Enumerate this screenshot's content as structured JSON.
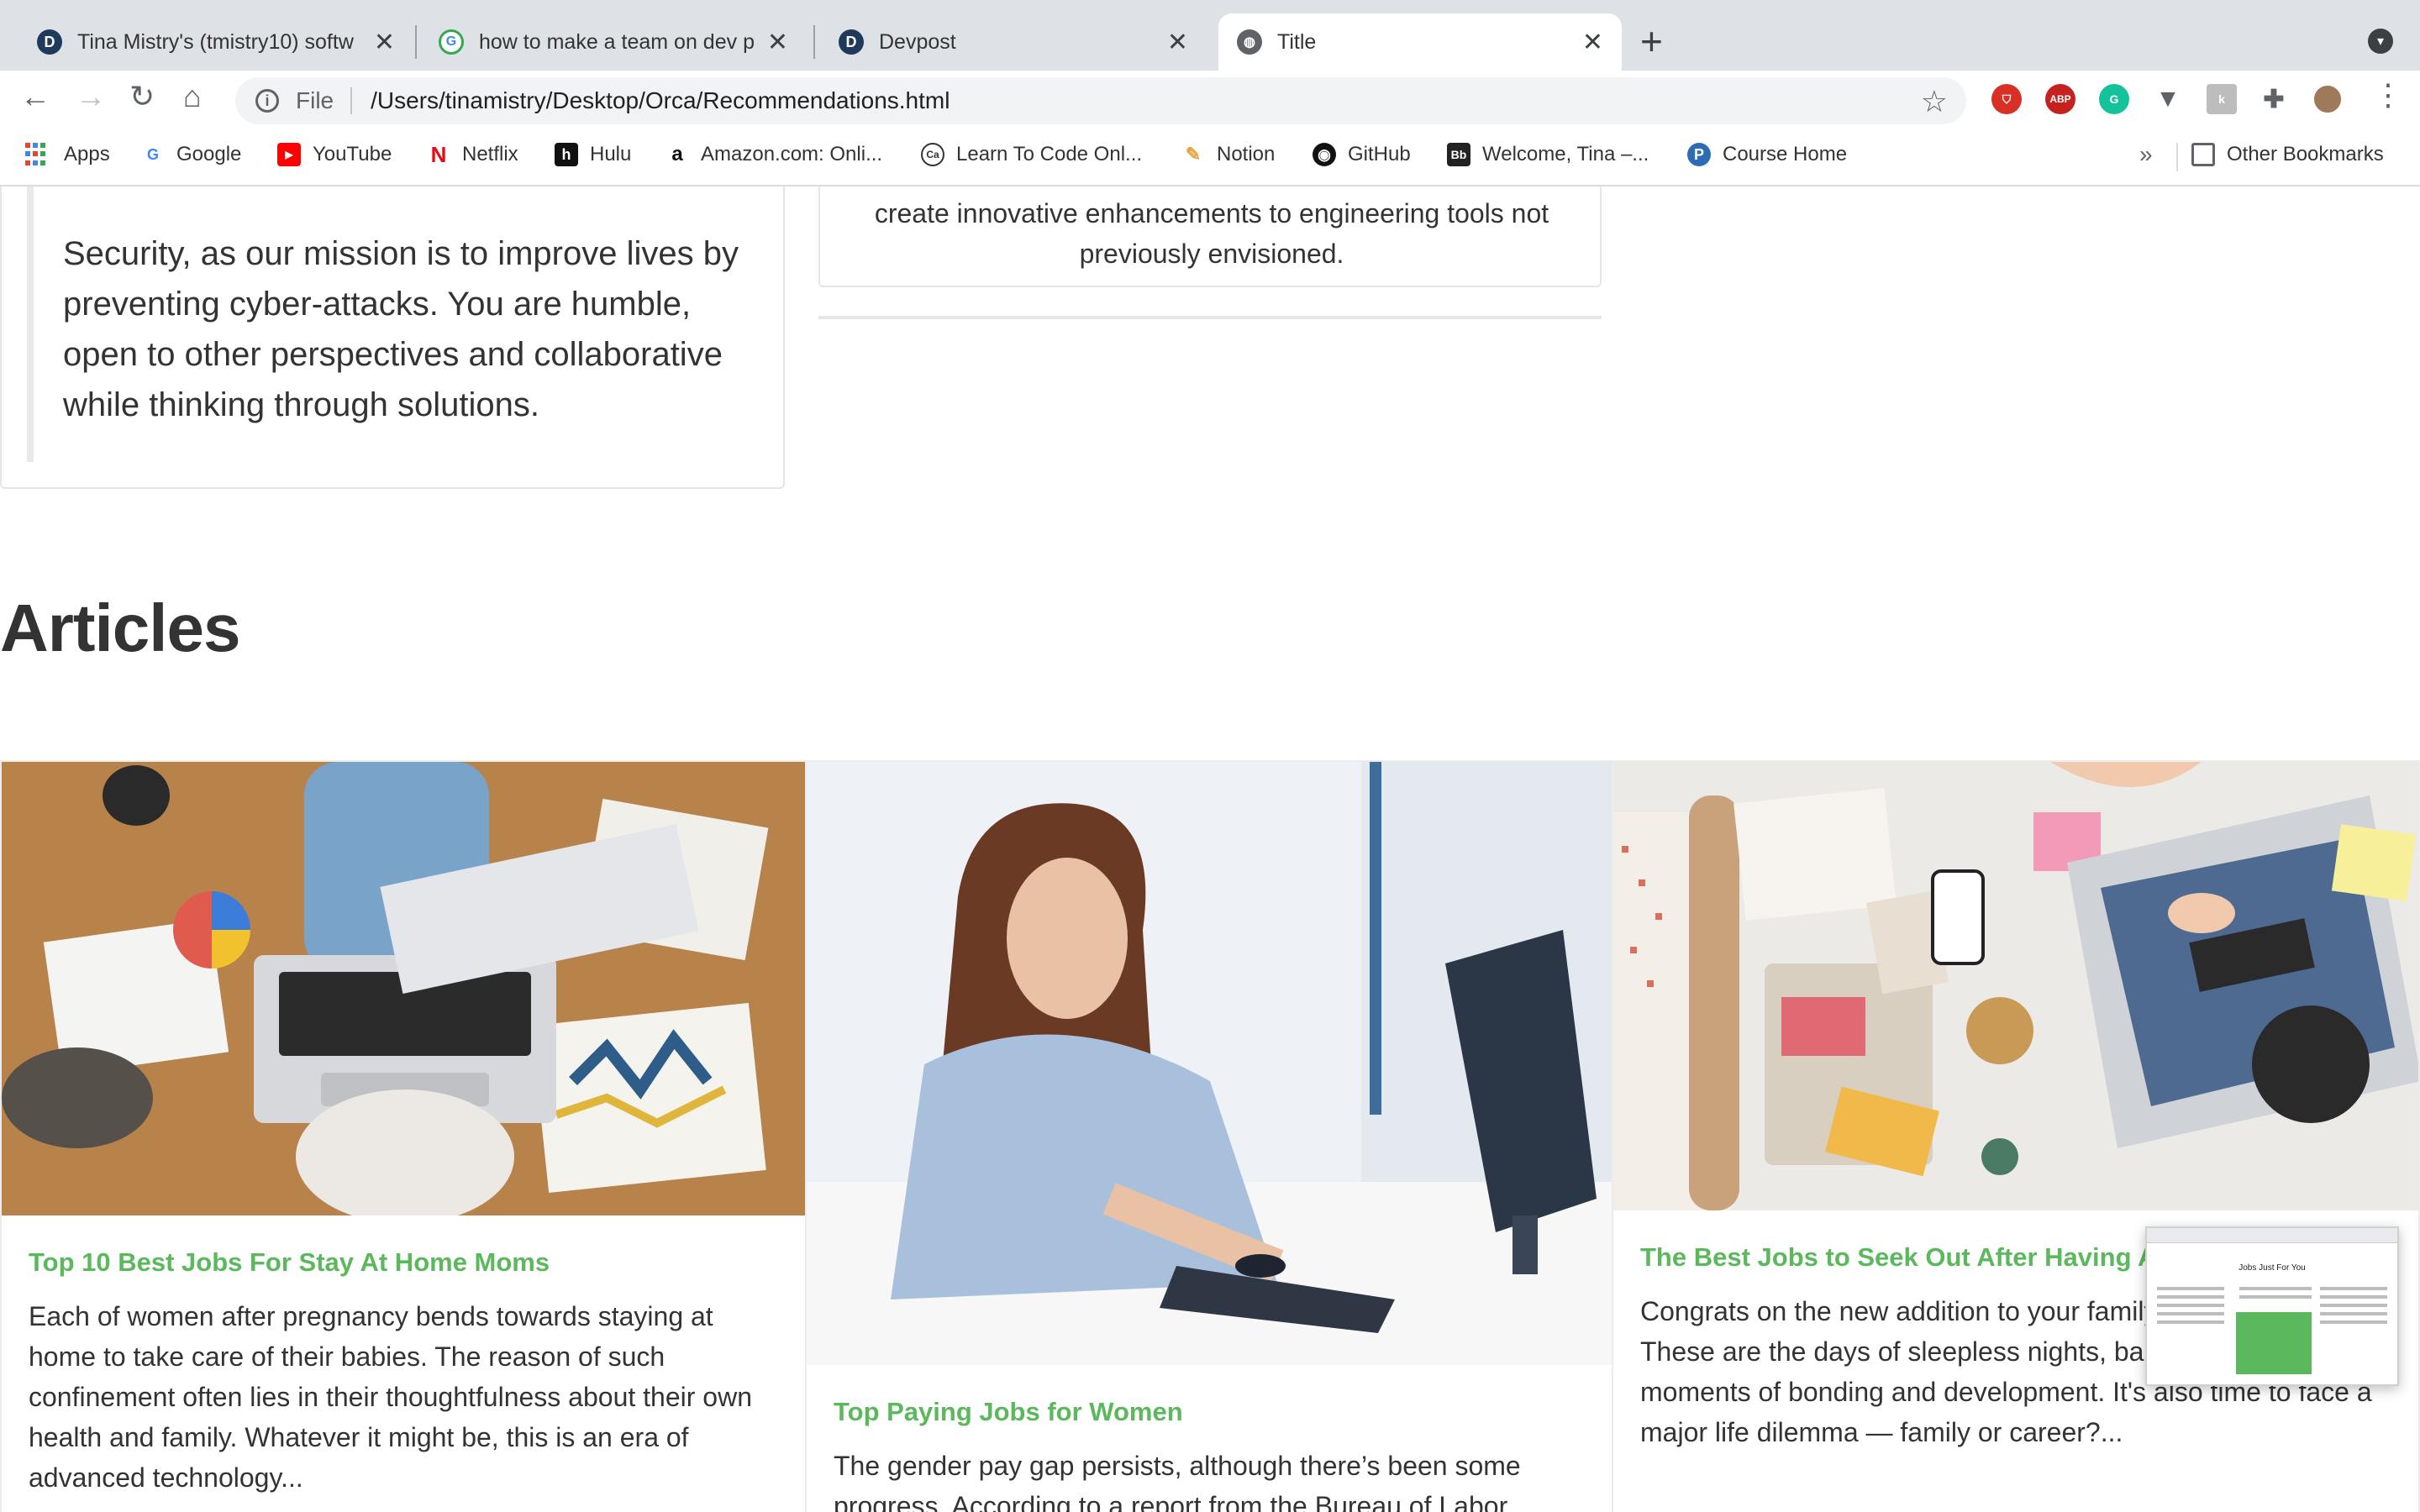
{
  "tabs": [
    {
      "title": "Tina Mistry's (tmistry10) softw",
      "icon": "devpost-icon"
    },
    {
      "title": "how to make a team on dev po",
      "icon": "google-icon"
    },
    {
      "title": "Devpost",
      "icon": "devpost-icon"
    },
    {
      "title": "Title",
      "icon": "globe-icon",
      "active": true
    }
  ],
  "address_bar": {
    "scheme": "File",
    "url": "/Users/tinamistry/Desktop/Orca/Recommendations.html"
  },
  "extensions": {
    "adblock_label": "ABP"
  },
  "bookmarks": [
    {
      "label": "Apps"
    },
    {
      "label": "Google"
    },
    {
      "label": "YouTube"
    },
    {
      "label": "Netflix"
    },
    {
      "label": "Hulu"
    },
    {
      "label": "Amazon.com: Onli..."
    },
    {
      "label": "Learn To Code Onl..."
    },
    {
      "label": "Notion"
    },
    {
      "label": "GitHub"
    },
    {
      "label": "Welcome, Tina –..."
    },
    {
      "label": "Course Home"
    }
  ],
  "other_bookmarks": "Other Bookmarks",
  "left_card": {
    "text": "Security, as our mission is to improve lives by preventing cyber-attacks. You are humble, open to other perspectives and collaborative while thinking through solutions."
  },
  "mid_card": {
    "text": "create innovative enhancements to engineering tools not previously envisioned."
  },
  "articles_heading": "Articles",
  "articles": [
    {
      "title": "Top 10 Best Jobs For Stay At Home Moms",
      "body": "Each of women after pregnancy bends towards staying at home to take care of their babies. The reason of such confinement often lies in their thoughtfulness about their own health and family. Whatever it might be, this is an era of advanced technology..."
    },
    {
      "title": "Top Paying Jobs for Women",
      "body": "The gender pay gap persists, although there’s been some progress. According to a report from the Bureau of Labor"
    },
    {
      "title": "The Best Jobs to Seek Out After Having A",
      "body": "Congrats on the new addition to your family and parenthood! These are the days of sleepless nights, babble and priceless moments of bonding and development. It's also time to face a major life dilemma — family or career?..."
    }
  ],
  "preview": {
    "title": "Jobs Just For You"
  },
  "colors": {
    "accent_green": "#5cb85c",
    "tabstrip": "#dee1e6",
    "text": "#333333"
  }
}
